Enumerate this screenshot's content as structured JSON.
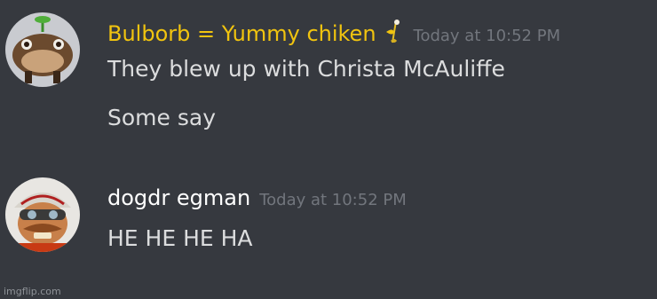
{
  "messages": [
    {
      "author": "Bulborb = Yummy chiken",
      "author_color": "#f1c40f",
      "badge_icon": "pikmin-leaf-icon",
      "timestamp": "Today at 10:52 PM",
      "lines": [
        "They blew up with Christa McAuliffe",
        "Some say"
      ]
    },
    {
      "author": "dogdr egman",
      "author_color": "#ffffff",
      "timestamp": "Today at 10:52 PM",
      "lines": [
        "HE HE HE HA"
      ]
    }
  ],
  "watermark": "imgflip.com",
  "colors": {
    "background": "#36393f",
    "message_text": "#dcddde",
    "timestamp": "#72767d"
  }
}
